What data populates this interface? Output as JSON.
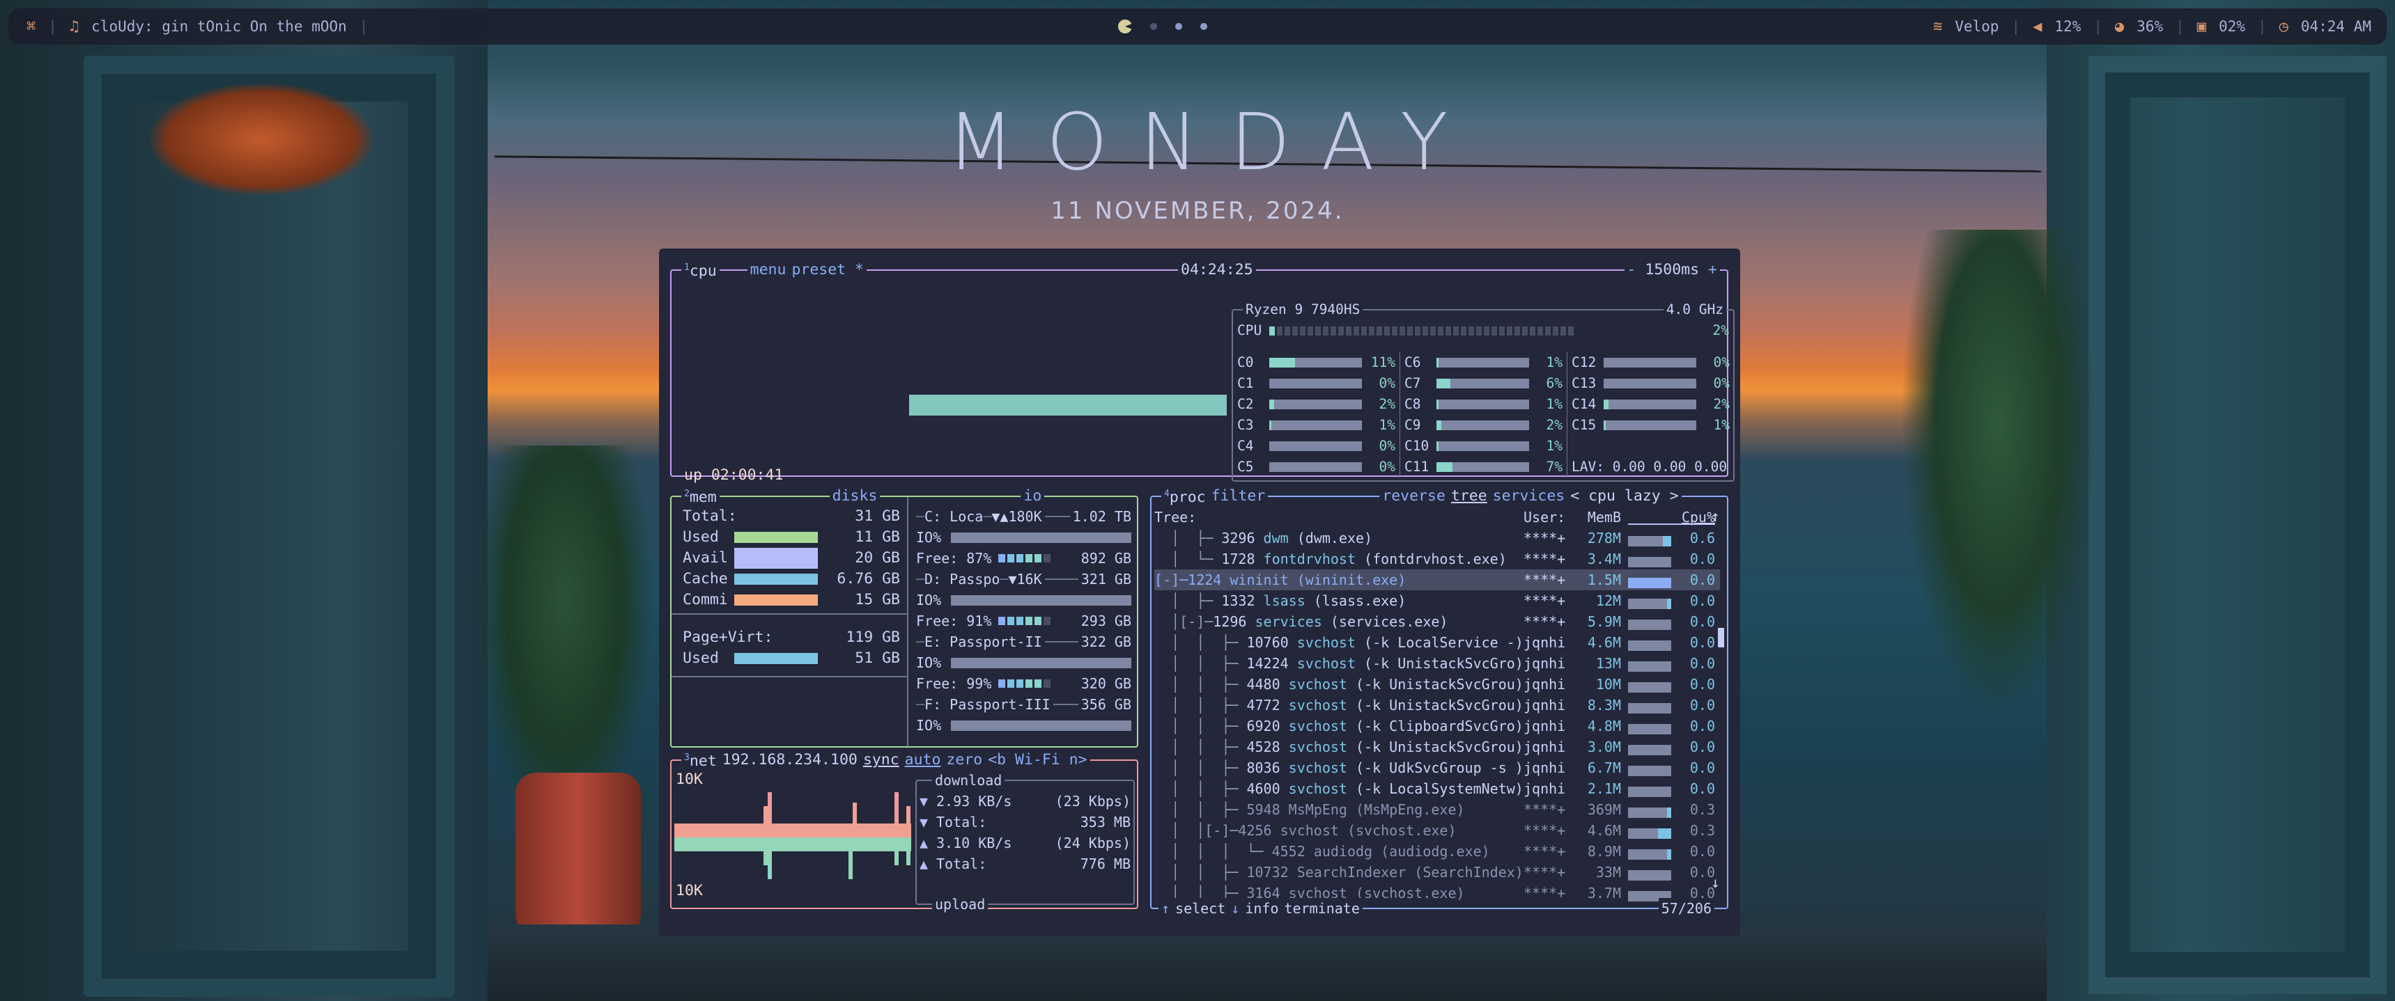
{
  "topbar": {
    "workspace_icon": "grid-icon",
    "music_icon": "music-note-icon",
    "now_playing": "cloUdy: gin tOnic On the mOOn",
    "workspaces": [
      "active",
      "empty",
      "occupied",
      "occupied"
    ],
    "wifi_name": "Velop",
    "volume": "12%",
    "battery": "36%",
    "cpu": "02%",
    "time": "04:24 AM"
  },
  "desktop": {
    "day": "MONDAY",
    "date": "11 NOVEMBER, 2024."
  },
  "btop": {
    "cpu": {
      "number": "1",
      "title": "cpu",
      "menu": "menu",
      "preset": "preset *",
      "clock": "04:24:25",
      "interval": "1500ms",
      "minus": "-",
      "plus": "+",
      "uptime": "up 02:00:41",
      "model": "Ryzen 9 7940HS",
      "freq": "4.0 GHz",
      "total_label": "CPU",
      "total_pct": "2%",
      "total_value": 0.02,
      "cores": [
        {
          "label": "C0",
          "pct": "11%",
          "value": 0.11
        },
        {
          "label": "C1",
          "pct": "0%",
          "value": 0
        },
        {
          "label": "C2",
          "pct": "2%",
          "value": 0.02
        },
        {
          "label": "C3",
          "pct": "1%",
          "value": 0.01
        },
        {
          "label": "C4",
          "pct": "0%",
          "value": 0
        },
        {
          "label": "C5",
          "pct": "0%",
          "value": 0
        },
        {
          "label": "C6",
          "pct": "1%",
          "value": 0.01
        },
        {
          "label": "C7",
          "pct": "6%",
          "value": 0.06
        },
        {
          "label": "C8",
          "pct": "1%",
          "value": 0.01
        },
        {
          "label": "C9",
          "pct": "2%",
          "value": 0.02
        },
        {
          "label": "C10",
          "pct": "1%",
          "value": 0.01
        },
        {
          "label": "C11",
          "pct": "7%",
          "value": 0.07
        },
        {
          "label": "C12",
          "pct": "0%",
          "value": 0
        },
        {
          "label": "C13",
          "pct": "0%",
          "value": 0
        },
        {
          "label": "C14",
          "pct": "2%",
          "value": 0.02
        },
        {
          "label": "C15",
          "pct": "1%",
          "value": 0.01
        }
      ],
      "lav": "LAV: 0.00 0.00 0.00"
    },
    "mem": {
      "number": "2",
      "title": "mem",
      "rows": [
        {
          "label": "Total:",
          "value": "31 GB"
        },
        {
          "label": "Used",
          "value": "11 GB",
          "color": "#a6da95"
        },
        {
          "label": "Avail",
          "value": "20 GB",
          "color": "#b7bdf8"
        },
        {
          "label": "Cache",
          "value": "6.76 GB",
          "color": "#7dc4e4"
        },
        {
          "label": "Commi",
          "value": "15 GB",
          "color": "#f5a97f"
        }
      ],
      "page_label": "Page+Virt:",
      "page_value": "119 GB",
      "page_used_label": "Used",
      "page_used_value": "51 GB"
    },
    "disks": {
      "title": "disks",
      "io_label": "io",
      "io_row_label": "IO%",
      "items": [
        {
          "name": "C: Loca",
          "io": "▼▲180K",
          "size": "1.02 TB",
          "free": "Free: 87%",
          "free_size": "892 GB"
        },
        {
          "name": "D: Passpo",
          "io": "▼16K",
          "size": "321 GB",
          "free": "Free: 91%",
          "free_size": "293 GB"
        },
        {
          "name": "E: Passport-II",
          "io": "",
          "size": "322 GB",
          "free": "Free: 99%",
          "free_size": "320 GB"
        },
        {
          "name": "F: Passport-III",
          "io": "",
          "size": "356 GB",
          "free": "",
          "free_size": ""
        }
      ]
    },
    "net": {
      "number": "3",
      "title": "net",
      "ip": "192.168.234.100",
      "sync": "sync",
      "auto": "auto",
      "zero": "zero",
      "iface": "<b Wi-Fi n>",
      "scale_top": "10K",
      "scale_bottom": "10K",
      "download_label": "download",
      "upload_label": "upload",
      "down_rate": "2.93 KB/s",
      "down_bits": "(23 Kbps)",
      "down_total_label": "Total:",
      "down_total": "353 MB",
      "up_rate": "3.10 KB/s",
      "up_bits": "(24 Kbps)",
      "up_total_label": "Total:",
      "up_total": "776 MB"
    },
    "proc": {
      "number": "4",
      "title": "proc",
      "filter": "filter",
      "reverse": "reverse",
      "tree": "tree",
      "services": "services",
      "sort": "< cpu lazy >",
      "head_tree": "Tree:",
      "head_user": "User:",
      "head_mem": "MemB",
      "head_cpu": "Cpu%",
      "rows": [
        {
          "tree": "  │  ├─ ",
          "pid": "3296",
          "name": "dwm",
          "args": " (dwm.exe)",
          "user": "****+",
          "mem": "278M",
          "cpu": "0.6",
          "bar": 0.2
        },
        {
          "tree": "  │  └─ ",
          "pid": "1728",
          "name": "fontdrvhost",
          "args": " (fontdrvhost.exe)",
          "user": "****+",
          "mem": "3.4M",
          "cpu": "0.0",
          "bar": 0
        },
        {
          "tree": "[-]─",
          "pid": "1224",
          "name": "wininit",
          "args": " (wininit.exe)",
          "user": "****+",
          "mem": "1.5M",
          "cpu": "0.0",
          "bar": 0,
          "selected": true
        },
        {
          "tree": "  │  ├─ ",
          "pid": "1332",
          "name": "lsass",
          "args": " (lsass.exe)",
          "user": "****+",
          "mem": "12M",
          "cpu": "0.0",
          "bar": 0.1
        },
        {
          "tree": "  │[-]─",
          "pid": "1296",
          "name": "services",
          "args": " (services.exe)",
          "user": "****+",
          "mem": "5.9M",
          "cpu": "0.0",
          "bar": 0
        },
        {
          "tree": "  │  │  ├─ ",
          "pid": "10760",
          "name": "svchost",
          "args": " (-k LocalService -)",
          "user": "jqnhi",
          "mem": "4.6M",
          "cpu": "0.0",
          "bar": 0
        },
        {
          "tree": "  │  │  ├─ ",
          "pid": "14224",
          "name": "svchost",
          "args": " (-k UnistackSvcGro)",
          "user": "jqnhi",
          "mem": "13M",
          "cpu": "0.0",
          "bar": 0
        },
        {
          "tree": "  │  │  ├─ ",
          "pid": "4480",
          "name": "svchost",
          "args": " (-k UnistackSvcGrou)",
          "user": "jqnhi",
          "mem": "10M",
          "cpu": "0.0",
          "bar": 0
        },
        {
          "tree": "  │  │  ├─ ",
          "pid": "4772",
          "name": "svchost",
          "args": " (-k UnistackSvcGrou)",
          "user": "jqnhi",
          "mem": "8.3M",
          "cpu": "0.0",
          "bar": 0
        },
        {
          "tree": "  │  │  ├─ ",
          "pid": "6920",
          "name": "svchost",
          "args": " (-k ClipboardSvcGro)",
          "user": "jqnhi",
          "mem": "4.8M",
          "cpu": "0.0",
          "bar": 0
        },
        {
          "tree": "  │  │  ├─ ",
          "pid": "4528",
          "name": "svchost",
          "args": " (-k UnistackSvcGrou)",
          "user": "jqnhi",
          "mem": "3.0M",
          "cpu": "0.0",
          "bar": 0
        },
        {
          "tree": "  │  │  ├─ ",
          "pid": "8036",
          "name": "svchost",
          "args": " (-k UdkSvcGroup -s )",
          "user": "jqnhi",
          "mem": "6.7M",
          "cpu": "0.0",
          "bar": 0
        },
        {
          "tree": "  │  │  ├─ ",
          "pid": "4600",
          "name": "svchost",
          "args": " (-k LocalSystemNetw)",
          "user": "jqnhi",
          "mem": "2.1M",
          "cpu": "0.0",
          "bar": 0
        },
        {
          "tree": "  │  │  ├─ ",
          "pid": "5948",
          "name": "MsMpEng",
          "args": " (MsMpEng.exe)",
          "user": "****+",
          "mem": "369M",
          "cpu": "0.3",
          "bar": 0.1,
          "dim": true
        },
        {
          "tree": "  │  │[-]─",
          "pid": "4256",
          "name": "svchost",
          "args": " (svchost.exe)",
          "user": "****+",
          "mem": "4.6M",
          "cpu": "0.3",
          "bar": 0.3,
          "dim": true
        },
        {
          "tree": "  │  │  │  └─ ",
          "pid": "4552",
          "name": "audiodg",
          "args": " (audiodg.exe)",
          "user": "****+",
          "mem": "8.9M",
          "cpu": "0.0",
          "bar": 0.1,
          "dim": true
        },
        {
          "tree": "  │  │  ├─ ",
          "pid": "10732",
          "name": "SearchIndexer",
          "args": " (SearchIndex)",
          "user": "****+",
          "mem": "33M",
          "cpu": "0.0",
          "bar": 0,
          "dim": true
        },
        {
          "tree": "  │  │  ├─ ",
          "pid": "3164",
          "name": "svchost",
          "args": " (svchost.exe)",
          "user": "****+",
          "mem": "3.7M",
          "cpu": "0.0",
          "bar": 0,
          "dim": true
        }
      ],
      "select": "select",
      "info": "info",
      "terminate": "terminate",
      "count": "57/206"
    }
  }
}
